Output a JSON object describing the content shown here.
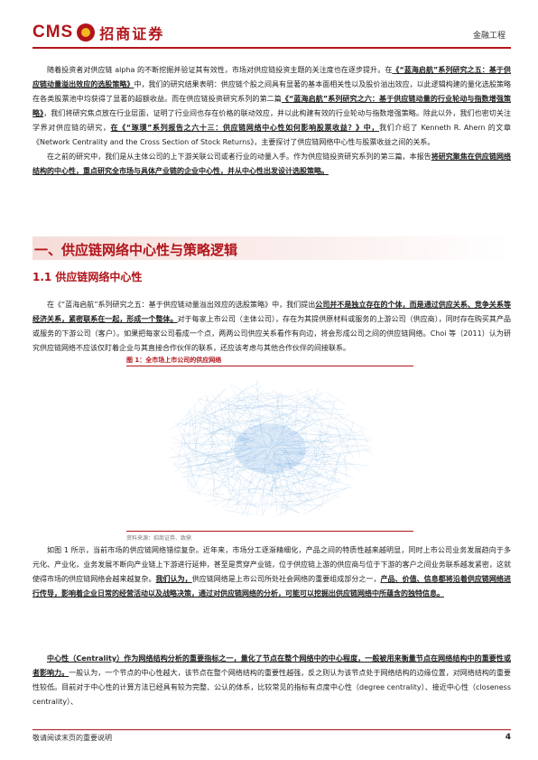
{
  "header": {
    "logo_latin": "CMS",
    "logo_cn": "招商证券",
    "report_type": "金融工程"
  },
  "p1": {
    "s1": "随着投资者对供应链 alpha 的不断挖掘并验证其有效性，市场对供应链投资主题的关注度也在逐步提升。在",
    "s2": "《“蓝海启航”系列研究之五：基于供应链动量溢出效应的选股策略》",
    "s3": "中，我们的研究结果表明：供应链个股之间具有显著的基本面相关性以及股价溢出效应，以此逻辑构建的量化选股策略在各类股票池中均获得了显著的超额收益。而在供应链投资研究系列的第二篇",
    "s4": "《“蓝海启航”系列研究之六：基于供应链动量的行业轮动与指数增强策略》",
    "s5": "，我们将研究焦点放在行业层面，证明了行业间也存在价格的联动效应，并以此构建有效的行业轮动与指数增强策略。除此以外，我们也密切关注学界对供应链的研究，",
    "s6": "在《“琢璞”系列报告之六十三：供应链网络中心性如何影响股票收益？》中，",
    "s7": "我们介绍了 Kenneth R. Ahern 的文章《Network Centrality and the Cross Section of Stock Returns》，主要探讨了供应链网络中心性与股票收益之间的关系。",
    "s8": "在之前的研究中，我们是从主体公司的上下游关联公司或者行业的动量入手。作为供应链投资研究系列的第三篇，本报告",
    "s9": "将研究聚焦在供应链网络结构的中心性，重点研究全市场与具体产业链的企业中心性，并从中心性出发设计选股策略。"
  },
  "section1": {
    "title": "一、供应链网络中心性与策略逻辑"
  },
  "subsection": {
    "title": "1.1 供应链网络中心性"
  },
  "p2": {
    "s1": "在《“蓝海启航”系列研究之五：基于供应链动量溢出效应的选股策略》中，我们提出",
    "s2": "公司并不是独立存在的个体，而是通过供应关系、竞争关系等经济关系，紧密联系在一起，形成一个整体。",
    "s3": "对于每家上市公司（主体公司），存在为其提供原材料或服务的上游公司（供应商），同时存在购买其产品或服务的下游公司（客户）。如果把每家公司看成一个点，两两公司供应关系看作有向边，将会形成公司之间的供应链网络。Choi 等（2011）认为研究供应链网络不应该仅盯着企业与其直接合作伙伴的联系，还应该考虑与其他合作伙伴的间接联系。"
  },
  "figure": {
    "title": "图 1：全市场上市公司的供应网络",
    "source": "资料来源：招商证券、致鼎"
  },
  "p3": {
    "s1": "如图 1 所示，当前市场的供应链网络错综复杂。近年来，市场分工逐渐精细化，产品之间的特质性越来越明显，同时上市公司业务发展趋向于多元化、产业化，业务发展不断向产业链上下游进行延伸，甚至是贯穿产业链，位于供应链上游的供应商与位于下游的客户之间业务联系越发紧密，这就使得市场的供应链网络会越来越复杂。",
    "s2": "我们认为，",
    "s3": "供应链网络是上市公司所处社会网络的重要组成部分之一，",
    "s4": "产品、价值、信息都将沿着供应链网络进行传导，影响着企业日常的经营活动以及战略决策，通过对供应链网络的分析，可能可以挖掘出供应链网络中所蕴含的独特信息。"
  },
  "p4": {
    "s1": "中心性（Centrality）作为网络结构分析的重要指标之一，量化了节点在整个网络中的中心程度，一般被用来衡量节点在网络结构中的重要性或者影响力。",
    "s2": "一般认为，一个节点的中心性越大，该节点在整个网络结构的重要性越强，反之则认为该节点处于网络结构的边缘位置，对网络结构的重要性较低。目前对于中心性的计算方法已经具有较为完整、公认的体系，比较常见的指标有点度中心性（degree centrality）、接近中心性（closeness centrality）、"
  },
  "footer": {
    "disclaimer": "敬请阅读末页的重要说明",
    "page": "4"
  },
  "colors": {
    "brand": "#b1151b",
    "network": "#4a8fd6"
  }
}
